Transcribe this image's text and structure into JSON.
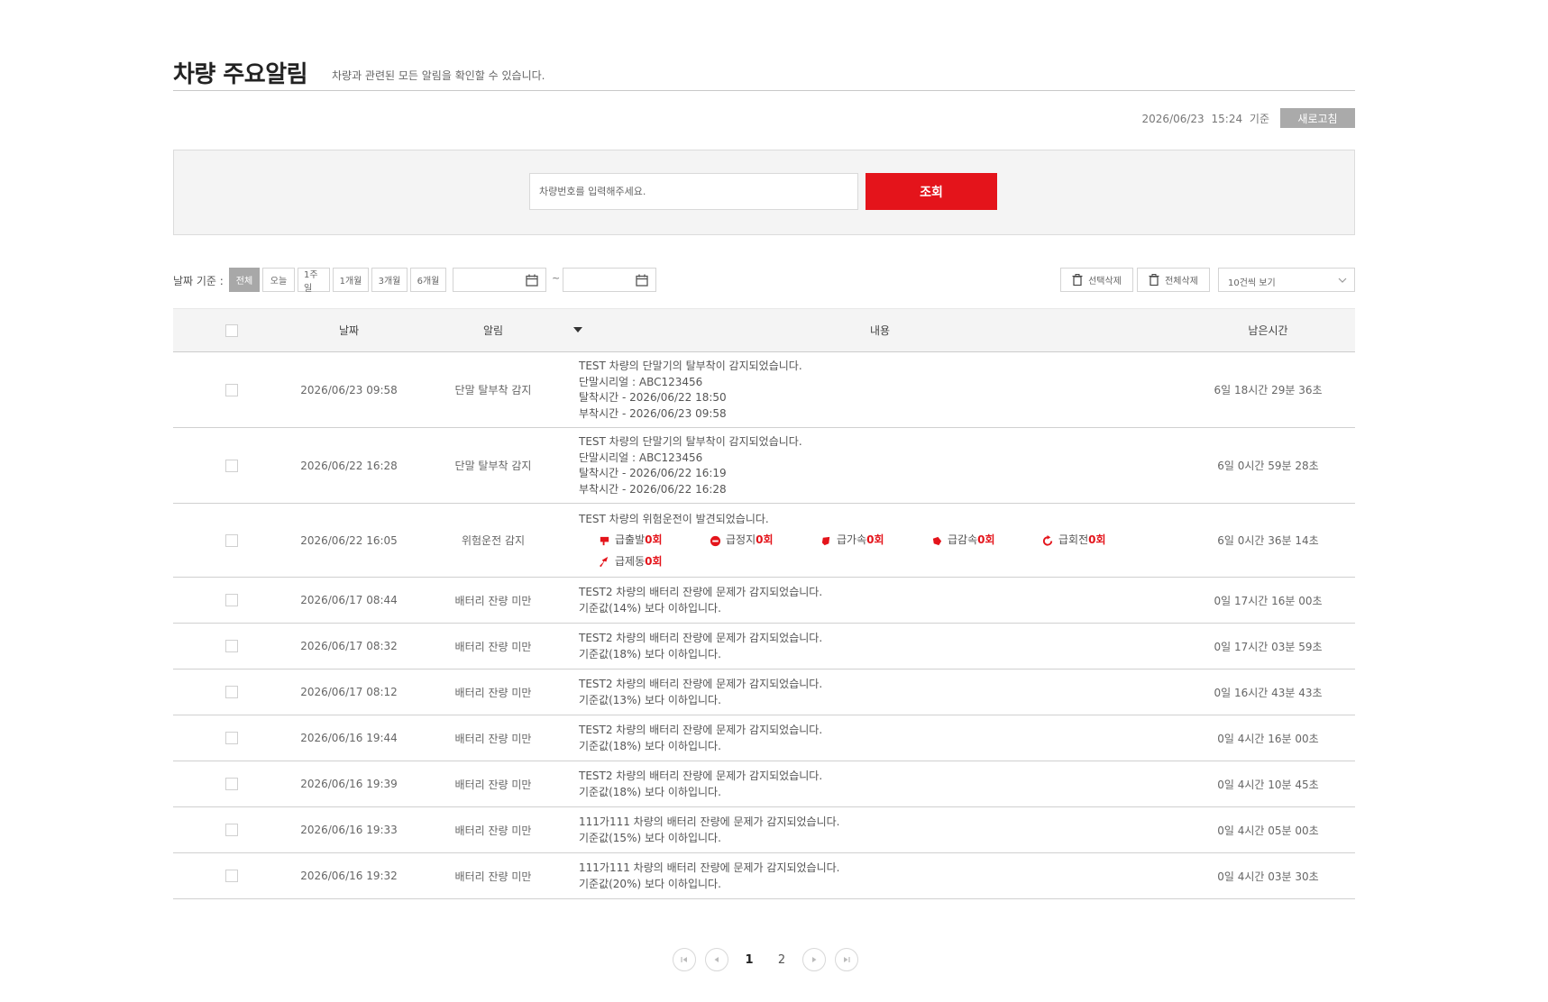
{
  "header": {
    "title": "차량 주요알림",
    "subtitle": "차량과 관련된 모든 알림을 확인할 수 있습니다."
  },
  "refresh": {
    "timestamp": "2026/06/23  15:24  기준",
    "button_label": "새로고침"
  },
  "search": {
    "placeholder": "차량번호를 입력해주세요.",
    "button_label": "조회"
  },
  "filter": {
    "label": "날짜 기준 :",
    "periods": [
      "전체",
      "오늘",
      "1주일",
      "1개월",
      "3개월",
      "6개월"
    ],
    "active_period": "전체",
    "tilde": "~",
    "delete_selected": "선택삭제",
    "delete_all": "전체삭제",
    "page_size": "10건씩 보기"
  },
  "table": {
    "headers": {
      "date": "날짜",
      "alert": "알림",
      "content": "내용",
      "remaining": "남은시간"
    },
    "rows": [
      {
        "date": "2026/06/23 09:58",
        "alert": "단말 탈부착 감지",
        "lines": [
          "TEST 차량의 단말기의 탈부착이 감지되었습니다.",
          "단말시리얼 : ABC123456",
          "탈착시간 - 2026/06/22 18:50",
          "부착시간 - 2026/06/23 09:58"
        ],
        "remaining": "6일 18시간 29분 36초"
      },
      {
        "date": "2026/06/22 16:28",
        "alert": "단말 탈부착 감지",
        "lines": [
          "TEST 차량의 단말기의 탈부착이 감지되었습니다.",
          "단말시리얼 : ABC123456",
          "탈착시간 - 2026/06/22 16:19",
          "부착시간 - 2026/06/22 16:28"
        ],
        "remaining": "6일 0시간 59분 28초"
      },
      {
        "date": "2026/06/22 16:05",
        "alert": "위험운전 감지",
        "lines": [
          "TEST 차량의 위험운전이 발견되었습니다."
        ],
        "risk": [
          {
            "label": "급출발",
            "count": "0회",
            "icon": "sudden-start-icon"
          },
          {
            "label": "급정지",
            "count": "0회",
            "icon": "sudden-stop-icon"
          },
          {
            "label": "급가속",
            "count": "0회",
            "icon": "sudden-accel-icon"
          },
          {
            "label": "급감속",
            "count": "0회",
            "icon": "sudden-decel-icon"
          },
          {
            "label": "급회전",
            "count": "0회",
            "icon": "sudden-turn-icon"
          },
          {
            "label": "급제동",
            "count": "0회",
            "icon": "sudden-brake-icon"
          }
        ],
        "remaining": "6일 0시간 36분 14초"
      },
      {
        "date": "2026/06/17 08:44",
        "alert": "배터리 잔량 미만",
        "lines": [
          "TEST2 차량의 배터리 잔량에 문제가 감지되었습니다.",
          "기준값(14%) 보다 이하입니다."
        ],
        "remaining": "0일 17시간 16분 00초"
      },
      {
        "date": "2026/06/17 08:32",
        "alert": "배터리 잔량 미만",
        "lines": [
          "TEST2 차량의 배터리 잔량에 문제가 감지되었습니다.",
          "기준값(18%) 보다 이하입니다."
        ],
        "remaining": "0일 17시간 03분 59초"
      },
      {
        "date": "2026/06/17 08:12",
        "alert": "배터리 잔량 미만",
        "lines": [
          "TEST2 차량의 배터리 잔량에 문제가 감지되었습니다.",
          "기준값(13%) 보다 이하입니다."
        ],
        "remaining": "0일 16시간 43분 43초"
      },
      {
        "date": "2026/06/16 19:44",
        "alert": "배터리 잔량 미만",
        "lines": [
          "TEST2 차량의 배터리 잔량에 문제가 감지되었습니다.",
          "기준값(18%) 보다 이하입니다."
        ],
        "remaining": "0일 4시간 16분 00초"
      },
      {
        "date": "2026/06/16 19:39",
        "alert": "배터리 잔량 미만",
        "lines": [
          "TEST2 차량의 배터리 잔량에 문제가 감지되었습니다.",
          "기준값(18%) 보다 이하입니다."
        ],
        "remaining": "0일 4시간 10분 45초"
      },
      {
        "date": "2026/06/16 19:33",
        "alert": "배터리 잔량 미만",
        "lines": [
          "111가111 차량의 배터리 잔량에 문제가 감지되었습니다.",
          "기준값(15%) 보다 이하입니다."
        ],
        "remaining": "0일 4시간 05분 00초"
      },
      {
        "date": "2026/06/16 19:32",
        "alert": "배터리 잔량 미만",
        "lines": [
          "111가111 차량의 배터리 잔량에 문제가 감지되었습니다.",
          "기준값(20%) 보다 이하입니다."
        ],
        "remaining": "0일 4시간 03분 30초"
      }
    ]
  },
  "pagination": {
    "pages": [
      "1",
      "2"
    ],
    "current": "1"
  },
  "colors": {
    "accent": "#e4141b",
    "refresh_button": "#aaaaaa",
    "active_period": "#a8a8a8"
  }
}
